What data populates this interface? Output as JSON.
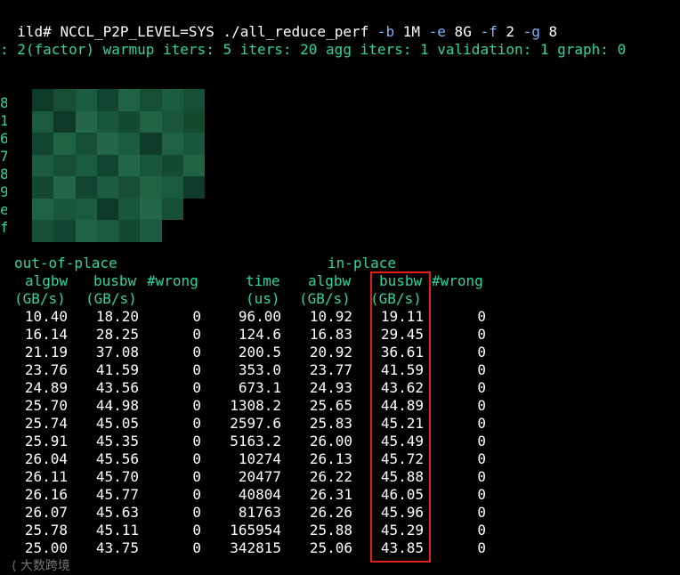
{
  "command": {
    "prompt": "ild# ",
    "env": "NCCL_P2P_LEVEL=SYS",
    "exe": " ./all_reduce_perf ",
    "args": [
      {
        "flag": "-b",
        "value": " 1M "
      },
      {
        "flag": "-e",
        "value": " 8G "
      },
      {
        "flag": "-f",
        "value": " 2 "
      },
      {
        "flag": "-g",
        "value": " 8"
      }
    ]
  },
  "info_line": ": 2(factor) warmup iters: 5 iters: 20 agg iters: 1 validation: 1 graph: 0",
  "left_fragments": [
    "8",
    "1",
    "6",
    "7",
    "8",
    "9",
    "e",
    "f"
  ],
  "headers": {
    "out_of_place": "out-of-place",
    "in_place": "in-place",
    "algbw": "algbw",
    "busbw": "busbw",
    "wrong": "#wrong",
    "time": "time",
    "gbs": "(GB/s)",
    "us": "(us)",
    "algbw2": "algbw",
    "busbw2": "busbw",
    "wrong2": "#wrong",
    "gbs2": "(GB/s)",
    "gbs3": "(GB/s)",
    "gbs4": "(GB/s)"
  },
  "rows": [
    {
      "algbw": "10.40",
      "busbw": "18.20",
      "wrong": "0",
      "time": "96.00",
      "algbw2": "10.92",
      "busbw2": "19.11",
      "wrong2": "0"
    },
    {
      "algbw": "16.14",
      "busbw": "28.25",
      "wrong": "0",
      "time": "124.6",
      "algbw2": "16.83",
      "busbw2": "29.45",
      "wrong2": "0"
    },
    {
      "algbw": "21.19",
      "busbw": "37.08",
      "wrong": "0",
      "time": "200.5",
      "algbw2": "20.92",
      "busbw2": "36.61",
      "wrong2": "0"
    },
    {
      "algbw": "23.76",
      "busbw": "41.59",
      "wrong": "0",
      "time": "353.0",
      "algbw2": "23.77",
      "busbw2": "41.59",
      "wrong2": "0"
    },
    {
      "algbw": "24.89",
      "busbw": "43.56",
      "wrong": "0",
      "time": "673.1",
      "algbw2": "24.93",
      "busbw2": "43.62",
      "wrong2": "0"
    },
    {
      "algbw": "25.70",
      "busbw": "44.98",
      "wrong": "0",
      "time": "1308.2",
      "algbw2": "25.65",
      "busbw2": "44.89",
      "wrong2": "0"
    },
    {
      "algbw": "25.74",
      "busbw": "45.05",
      "wrong": "0",
      "time": "2597.6",
      "algbw2": "25.83",
      "busbw2": "45.21",
      "wrong2": "0"
    },
    {
      "algbw": "25.91",
      "busbw": "45.35",
      "wrong": "0",
      "time": "5163.2",
      "algbw2": "26.00",
      "busbw2": "45.49",
      "wrong2": "0"
    },
    {
      "algbw": "26.04",
      "busbw": "45.56",
      "wrong": "0",
      "time": "10274",
      "algbw2": "26.13",
      "busbw2": "45.72",
      "wrong2": "0"
    },
    {
      "algbw": "26.11",
      "busbw": "45.70",
      "wrong": "0",
      "time": "20477",
      "algbw2": "26.22",
      "busbw2": "45.88",
      "wrong2": "0"
    },
    {
      "algbw": "26.16",
      "busbw": "45.77",
      "wrong": "0",
      "time": "40804",
      "algbw2": "26.31",
      "busbw2": "46.05",
      "wrong2": "0"
    },
    {
      "algbw": "26.07",
      "busbw": "45.63",
      "wrong": "0",
      "time": "81763",
      "algbw2": "26.26",
      "busbw2": "45.96",
      "wrong2": "0"
    },
    {
      "algbw": "25.78",
      "busbw": "45.11",
      "wrong": "0",
      "time": "165954",
      "algbw2": "25.88",
      "busbw2": "45.29",
      "wrong2": "0"
    },
    {
      "algbw": "25.00",
      "busbw": "43.75",
      "wrong": "0",
      "time": "342815",
      "algbw2": "25.06",
      "busbw2": "43.85",
      "wrong2": "0"
    }
  ],
  "watermark": "大数跨境",
  "colors": {
    "background": "#000000",
    "text": "#ffffff",
    "accent": "#2dd6a0",
    "flag": "#7ab6ff",
    "highlight": "#e02020"
  }
}
